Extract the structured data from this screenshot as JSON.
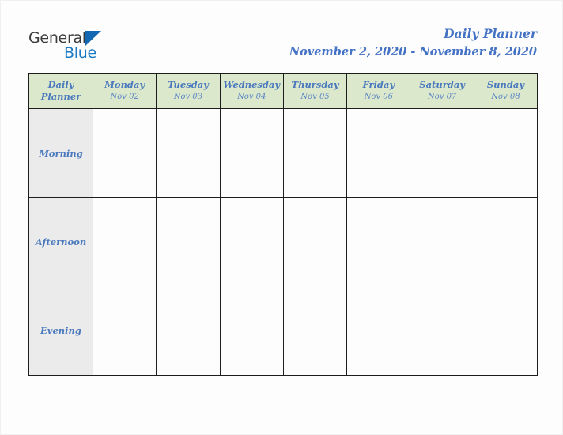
{
  "brand": {
    "word_one": "General",
    "word_two": "Blue",
    "triangle_icon": "triangle-logo-icon",
    "accent_blue": "#1268b3",
    "text_gray": "#3b3b3b"
  },
  "header": {
    "title": "Daily Planner",
    "date_range": "November 2, 2020 - November 8, 2020",
    "title_color": "#4472c4"
  },
  "table": {
    "corner_label_line1": "Daily",
    "corner_label_line2": "Planner",
    "header_bg": "#dce8cc",
    "row_label_bg": "#ebebeb",
    "cell_bg": "#fdfdfd",
    "border_color": "#1d1d1d",
    "text_blue": "#4a79bd",
    "columns": [
      {
        "day": "Monday",
        "date": "Nov 02"
      },
      {
        "day": "Tuesday",
        "date": "Nov 03"
      },
      {
        "day": "Wednesday",
        "date": "Nov 04"
      },
      {
        "day": "Thursday",
        "date": "Nov 05"
      },
      {
        "day": "Friday",
        "date": "Nov 06"
      },
      {
        "day": "Saturday",
        "date": "Nov 07"
      },
      {
        "day": "Sunday",
        "date": "Nov 08"
      }
    ],
    "rows": [
      {
        "label": "Morning",
        "cells": [
          "",
          "",
          "",
          "",
          "",
          "",
          ""
        ]
      },
      {
        "label": "Afternoon",
        "cells": [
          "",
          "",
          "",
          "",
          "",
          "",
          ""
        ]
      },
      {
        "label": "Evening",
        "cells": [
          "",
          "",
          "",
          "",
          "",
          "",
          ""
        ]
      }
    ]
  }
}
